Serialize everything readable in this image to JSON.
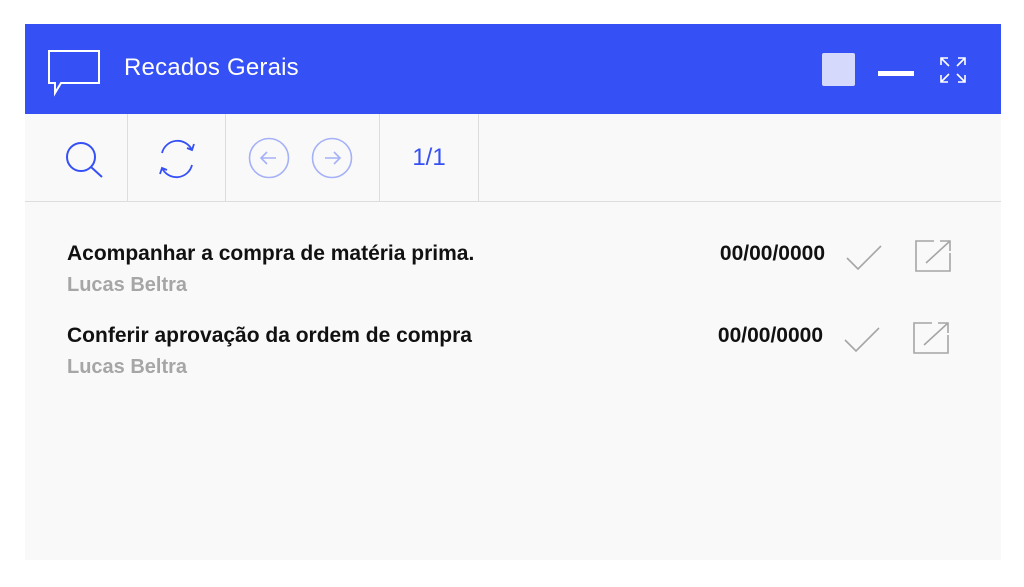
{
  "window": {
    "title": "Recados Gerais",
    "accent_color": "#3550f5",
    "controls": [
      "color-square",
      "minimize-icon",
      "expand-icon"
    ]
  },
  "toolbar": {
    "buttons": [
      "search-icon",
      "refresh-icon",
      "prev-page-icon",
      "next-page-icon"
    ],
    "page_indicator": "1/1"
  },
  "messages": [
    {
      "title": "Acompanhar a compra de matéria prima.",
      "author": "Lucas Beltra",
      "date": "00/00/0000",
      "actions": [
        "check-icon",
        "edit-icon"
      ]
    },
    {
      "title": "Conferir aprovação da ordem de compra",
      "author": "Lucas Beltra",
      "date": "00/00/0000",
      "actions": [
        "check-icon",
        "edit-icon"
      ]
    }
  ]
}
